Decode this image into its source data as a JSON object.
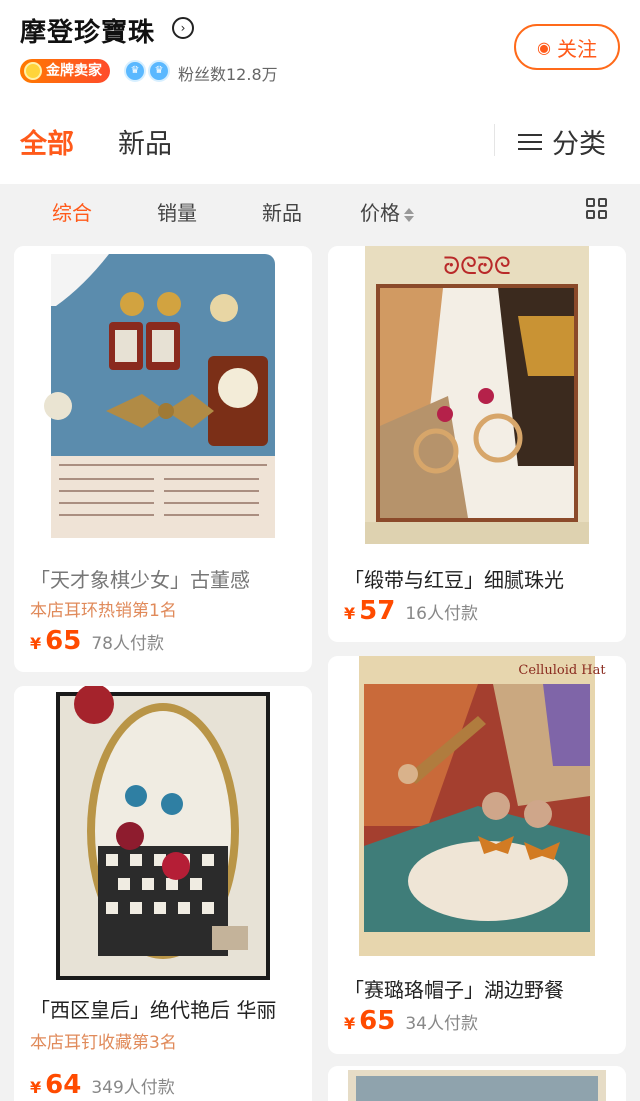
{
  "shop": {
    "name": "摩登珍寶珠",
    "arrow_icon": "chevron-right-circle-icon",
    "badge": "金牌卖家",
    "fans": "粉丝数12.8万",
    "follow_label": "关注",
    "follow_icon": "wifi-broadcast-icon"
  },
  "tabs": {
    "all": "全部",
    "new": "新品",
    "category": "分类"
  },
  "sort": {
    "items": [
      "综合",
      "销量",
      "新品",
      "价格"
    ],
    "active": "综合"
  },
  "products": [
    {
      "title": "「天才象棋少女」古董感",
      "rank": "本店耳环热销第1名",
      "currency": "¥",
      "price": "65",
      "sold": "78人付款"
    },
    {
      "title": "「缎带与红豆」细腻珠光",
      "rank": "",
      "currency": "¥",
      "price": "57",
      "sold": "16人付款"
    },
    {
      "title": "「西区皇后」绝代艳后 华丽",
      "rank": "本店耳钉收藏第3名",
      "currency": "¥",
      "price": "64",
      "sold": "349人付款"
    },
    {
      "title": "「赛璐珞帽子」湖边野餐",
      "rank": "",
      "currency": "¥",
      "price": "65",
      "sold": "34人付款"
    }
  ],
  "colors": {
    "accent": "#ff5a1a",
    "price": "#ff4b00",
    "rank": "#e08a5a"
  }
}
